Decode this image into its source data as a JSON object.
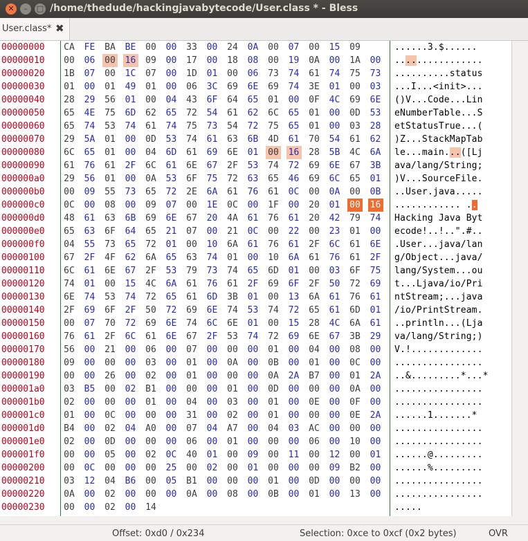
{
  "window": {
    "title": "/home/thedude/hackingjavabytecode/User.class * - Bless"
  },
  "tab": {
    "label": "User.class*"
  },
  "status": {
    "offset": "Offset: 0xd0 / 0x234",
    "selection": "Selection: 0xce to 0xcf (0x2 bytes)",
    "mode": "OVR"
  },
  "colors": {
    "offset": "#c2001a",
    "byte_even": "#3c3c3c",
    "byte_odd": "#2a2ab8",
    "highlight": "#f6c3ad",
    "selection": "#ee6c2f"
  },
  "hexdump": [
    {
      "offset": "00000000",
      "bytes": [
        "CA",
        "FE",
        "BA",
        "BE",
        "00",
        "00",
        "33",
        "00",
        "24",
        "0A",
        "00",
        "07",
        "00",
        "15",
        "09"
      ],
      "ascii": "......3.$......"
    },
    {
      "offset": "00000010",
      "bytes": [
        "00",
        "06",
        "00",
        "16",
        "09",
        "00",
        "17",
        "00",
        "18",
        "08",
        "00",
        "19",
        "0A",
        "00",
        "1A",
        "00"
      ],
      "ascii": "................"
    },
    {
      "offset": "00000020",
      "bytes": [
        "1B",
        "07",
        "00",
        "1C",
        "07",
        "00",
        "1D",
        "01",
        "00",
        "06",
        "73",
        "74",
        "61",
        "74",
        "75",
        "73"
      ],
      "ascii": "..........status"
    },
    {
      "offset": "00000030",
      "bytes": [
        "01",
        "00",
        "01",
        "49",
        "01",
        "00",
        "06",
        "3C",
        "69",
        "6E",
        "69",
        "74",
        "3E",
        "01",
        "00",
        "03"
      ],
      "ascii": "...I...<init>..."
    },
    {
      "offset": "00000040",
      "bytes": [
        "28",
        "29",
        "56",
        "01",
        "00",
        "04",
        "43",
        "6F",
        "64",
        "65",
        "01",
        "00",
        "0F",
        "4C",
        "69",
        "6E"
      ],
      "ascii": "()V...Code...Lin"
    },
    {
      "offset": "00000050",
      "bytes": [
        "65",
        "4E",
        "75",
        "6D",
        "62",
        "65",
        "72",
        "54",
        "61",
        "62",
        "6C",
        "65",
        "01",
        "00",
        "0D",
        "53"
      ],
      "ascii": "eNumberTable...S"
    },
    {
      "offset": "00000060",
      "bytes": [
        "65",
        "74",
        "53",
        "74",
        "61",
        "74",
        "75",
        "73",
        "54",
        "72",
        "75",
        "65",
        "01",
        "00",
        "03",
        "28"
      ],
      "ascii": "etStatusTrue...("
    },
    {
      "offset": "00000070",
      "bytes": [
        "29",
        "5A",
        "01",
        "00",
        "0D",
        "53",
        "74",
        "61",
        "63",
        "6B",
        "4D",
        "61",
        "70",
        "54",
        "61",
        "62"
      ],
      "ascii": ")Z...StackMapTab"
    },
    {
      "offset": "00000080",
      "bytes": [
        "6C",
        "65",
        "01",
        "00",
        "04",
        "6D",
        "61",
        "69",
        "6E",
        "01",
        "00",
        "16",
        "28",
        "5B",
        "4C",
        "6A"
      ],
      "ascii": "le...main...([Lj"
    },
    {
      "offset": "00000090",
      "bytes": [
        "61",
        "76",
        "61",
        "2F",
        "6C",
        "61",
        "6E",
        "67",
        "2F",
        "53",
        "74",
        "72",
        "69",
        "6E",
        "67",
        "3B"
      ],
      "ascii": "ava/lang/String;"
    },
    {
      "offset": "000000a0",
      "bytes": [
        "29",
        "56",
        "01",
        "00",
        "0A",
        "53",
        "6F",
        "75",
        "72",
        "63",
        "65",
        "46",
        "69",
        "6C",
        "65",
        "01"
      ],
      "ascii": ")V...SourceFile."
    },
    {
      "offset": "000000b0",
      "bytes": [
        "00",
        "09",
        "55",
        "73",
        "65",
        "72",
        "2E",
        "6A",
        "61",
        "76",
        "61",
        "0C",
        "00",
        "0A",
        "00",
        "0B"
      ],
      "ascii": "..User.java....."
    },
    {
      "offset": "000000c0",
      "bytes": [
        "0C",
        "00",
        "08",
        "00",
        "09",
        "07",
        "00",
        "1E",
        "0C",
        "00",
        "1F",
        "00",
        "20",
        "01",
        "00",
        "16"
      ],
      "ascii": "............ .. "
    },
    {
      "offset": "000000d0",
      "bytes": [
        "48",
        "61",
        "63",
        "6B",
        "69",
        "6E",
        "67",
        "20",
        "4A",
        "61",
        "76",
        "61",
        "20",
        "42",
        "79",
        "74"
      ],
      "ascii": "Hacking Java Byt"
    },
    {
      "offset": "000000e0",
      "bytes": [
        "65",
        "63",
        "6F",
        "64",
        "65",
        "21",
        "07",
        "00",
        "21",
        "0C",
        "00",
        "22",
        "00",
        "23",
        "01",
        "00"
      ],
      "ascii": "ecode!..!..\".#.."
    },
    {
      "offset": "000000f0",
      "bytes": [
        "04",
        "55",
        "73",
        "65",
        "72",
        "01",
        "00",
        "10",
        "6A",
        "61",
        "76",
        "61",
        "2F",
        "6C",
        "61",
        "6E"
      ],
      "ascii": ".User...java/lan"
    },
    {
      "offset": "00000100",
      "bytes": [
        "67",
        "2F",
        "4F",
        "62",
        "6A",
        "65",
        "63",
        "74",
        "01",
        "00",
        "10",
        "6A",
        "61",
        "76",
        "61",
        "2F"
      ],
      "ascii": "g/Object...java/"
    },
    {
      "offset": "00000110",
      "bytes": [
        "6C",
        "61",
        "6E",
        "67",
        "2F",
        "53",
        "79",
        "73",
        "74",
        "65",
        "6D",
        "01",
        "00",
        "03",
        "6F",
        "75"
      ],
      "ascii": "lang/System...ou"
    },
    {
      "offset": "00000120",
      "bytes": [
        "74",
        "01",
        "00",
        "15",
        "4C",
        "6A",
        "61",
        "76",
        "61",
        "2F",
        "69",
        "6F",
        "2F",
        "50",
        "72",
        "69"
      ],
      "ascii": "t...Ljava/io/Pri"
    },
    {
      "offset": "00000130",
      "bytes": [
        "6E",
        "74",
        "53",
        "74",
        "72",
        "65",
        "61",
        "6D",
        "3B",
        "01",
        "00",
        "13",
        "6A",
        "61",
        "76",
        "61"
      ],
      "ascii": "ntStream;...java"
    },
    {
      "offset": "00000140",
      "bytes": [
        "2F",
        "69",
        "6F",
        "2F",
        "50",
        "72",
        "69",
        "6E",
        "74",
        "53",
        "74",
        "72",
        "65",
        "61",
        "6D",
        "01"
      ],
      "ascii": "/io/PrintStream."
    },
    {
      "offset": "00000150",
      "bytes": [
        "00",
        "07",
        "70",
        "72",
        "69",
        "6E",
        "74",
        "6C",
        "6E",
        "01",
        "00",
        "15",
        "28",
        "4C",
        "6A",
        "61"
      ],
      "ascii": "..println...(Lja"
    },
    {
      "offset": "00000160",
      "bytes": [
        "76",
        "61",
        "2F",
        "6C",
        "61",
        "6E",
        "67",
        "2F",
        "53",
        "74",
        "72",
        "69",
        "6E",
        "67",
        "3B",
        "29"
      ],
      "ascii": "va/lang/String;)"
    },
    {
      "offset": "00000170",
      "bytes": [
        "56",
        "00",
        "21",
        "00",
        "06",
        "00",
        "07",
        "00",
        "00",
        "00",
        "01",
        "00",
        "04",
        "00",
        "08",
        "00"
      ],
      "ascii": "V.!............."
    },
    {
      "offset": "00000180",
      "bytes": [
        "09",
        "00",
        "00",
        "00",
        "03",
        "00",
        "01",
        "00",
        "0A",
        "00",
        "0B",
        "00",
        "01",
        "00",
        "0C",
        "00"
      ],
      "ascii": "................"
    },
    {
      "offset": "00000190",
      "bytes": [
        "00",
        "00",
        "26",
        "00",
        "02",
        "00",
        "01",
        "00",
        "00",
        "00",
        "0A",
        "2A",
        "B7",
        "00",
        "01",
        "2A"
      ],
      "ascii": "..&.........*...*"
    },
    {
      "offset": "000001a0",
      "bytes": [
        "03",
        "B5",
        "00",
        "02",
        "B1",
        "00",
        "00",
        "00",
        "01",
        "00",
        "0D",
        "00",
        "00",
        "00",
        "0A",
        "00"
      ],
      "ascii": "................"
    },
    {
      "offset": "000001b0",
      "bytes": [
        "02",
        "00",
        "00",
        "00",
        "01",
        "00",
        "04",
        "00",
        "03",
        "00",
        "01",
        "00",
        "0E",
        "00",
        "0F",
        "00"
      ],
      "ascii": "................"
    },
    {
      "offset": "000001c0",
      "bytes": [
        "01",
        "00",
        "0C",
        "00",
        "00",
        "00",
        "31",
        "00",
        "02",
        "00",
        "01",
        "00",
        "00",
        "00",
        "0E",
        "2A"
      ],
      "ascii": "......1.......*"
    },
    {
      "offset": "000001d0",
      "bytes": [
        "B4",
        "00",
        "02",
        "04",
        "A0",
        "00",
        "07",
        "04",
        "A7",
        "00",
        "04",
        "03",
        "AC",
        "00",
        "00",
        "00"
      ],
      "ascii": "................"
    },
    {
      "offset": "000001e0",
      "bytes": [
        "02",
        "00",
        "0D",
        "00",
        "00",
        "00",
        "06",
        "00",
        "01",
        "00",
        "00",
        "00",
        "06",
        "00",
        "10",
        "00"
      ],
      "ascii": "................"
    },
    {
      "offset": "000001f0",
      "bytes": [
        "00",
        "00",
        "05",
        "00",
        "02",
        "0C",
        "40",
        "01",
        "00",
        "09",
        "00",
        "11",
        "00",
        "12",
        "00",
        "01"
      ],
      "ascii": "......@........."
    },
    {
      "offset": "00000200",
      "bytes": [
        "00",
        "0C",
        "00",
        "00",
        "00",
        "25",
        "00",
        "02",
        "00",
        "01",
        "00",
        "00",
        "00",
        "09",
        "B2",
        "00"
      ],
      "ascii": "......%........."
    },
    {
      "offset": "00000210",
      "bytes": [
        "03",
        "12",
        "04",
        "B6",
        "00",
        "05",
        "B1",
        "00",
        "00",
        "00",
        "01",
        "00",
        "0D",
        "00",
        "00",
        "00"
      ],
      "ascii": "................"
    },
    {
      "offset": "00000220",
      "bytes": [
        "0A",
        "00",
        "02",
        "00",
        "00",
        "00",
        "0A",
        "00",
        "08",
        "00",
        "0B",
        "00",
        "01",
        "00",
        "13",
        "00"
      ],
      "ascii": "................"
    },
    {
      "offset": "00000230",
      "bytes": [
        "00",
        "00",
        "02",
        "00",
        "14"
      ],
      "ascii": "....."
    }
  ]
}
